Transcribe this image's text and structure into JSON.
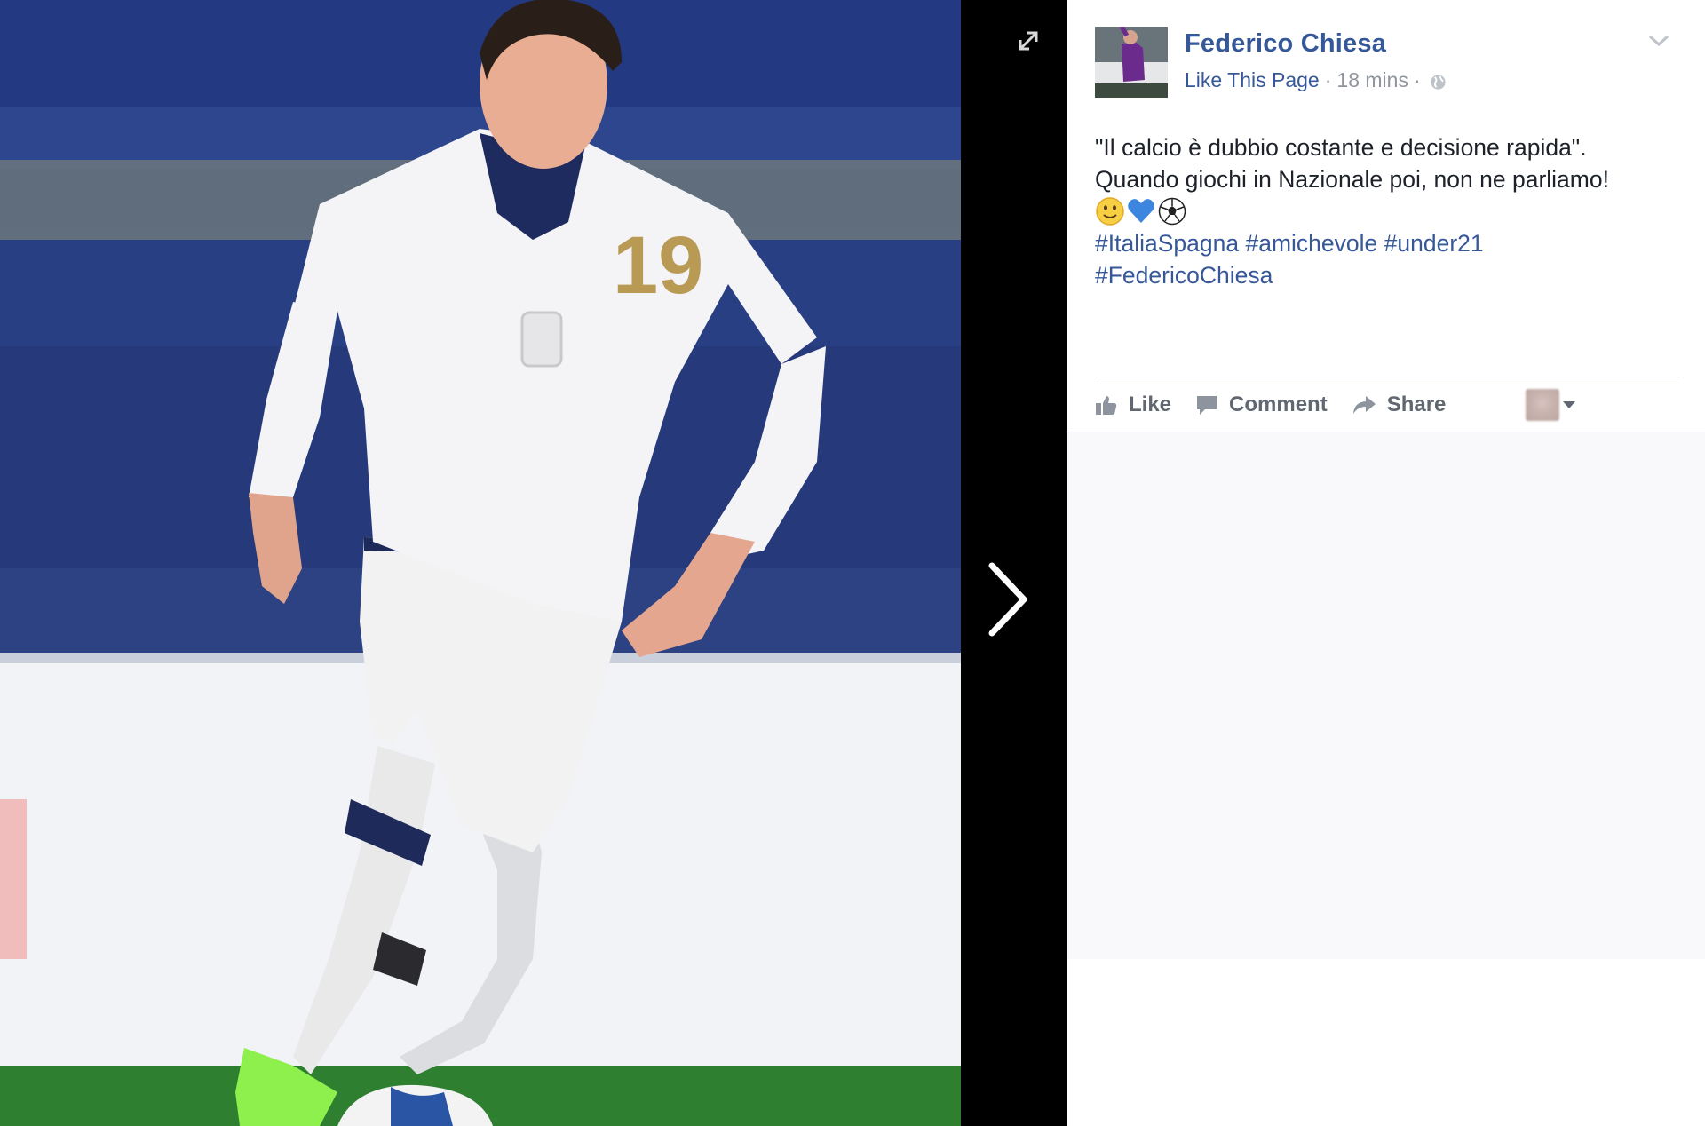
{
  "viewer": {
    "photo_description_icon": "photo",
    "expand_icon": "expand-arrows-icon",
    "next_icon": "chevron-right-icon",
    "jersey_number": "19"
  },
  "post": {
    "author": "Federico Chiesa",
    "like_page": "Like This Page",
    "separator": "·",
    "time": "18 mins",
    "audience_icon": "globe-icon",
    "options_icon": "chevron-down-icon",
    "caption_line1": "\"Il calcio è dubbio costante e decisione rapida\".",
    "caption_line2": "Quando giochi in Nazionale poi, non ne parliamo!",
    "emojis": [
      "slightly-smiling-face",
      "blue-heart",
      "soccer-ball"
    ],
    "hashtags_line1": [
      "#ItaliaSpagna",
      "#amichevole",
      "#under21"
    ],
    "hashtags_line2": [
      "#FedericoChiesa"
    ]
  },
  "actions": {
    "like": "Like",
    "comment": "Comment",
    "share": "Share"
  },
  "colors": {
    "link": "#365899",
    "meta": "#90949c",
    "text": "#1d2129",
    "action": "#616770"
  }
}
